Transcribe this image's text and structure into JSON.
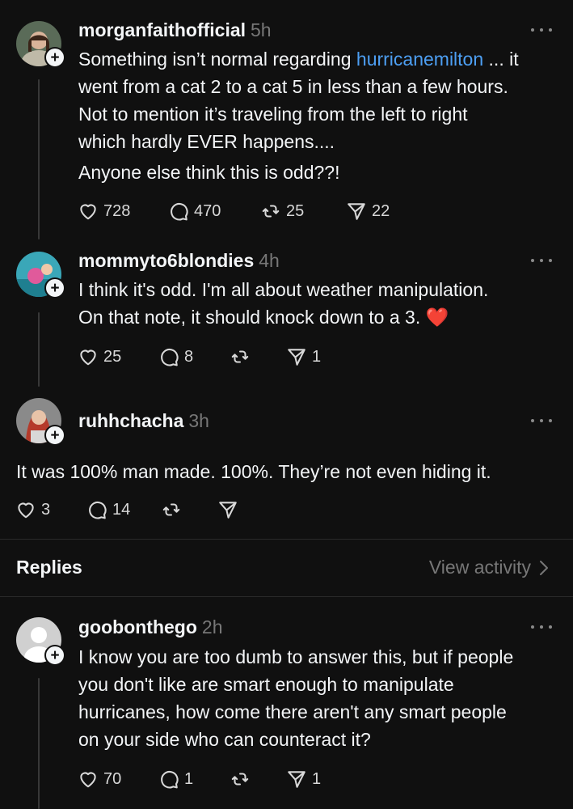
{
  "posts": [
    {
      "username": "morganfaithofficial",
      "time": "5h",
      "lines": [
        "Something isn’t normal regarding ",
        "hurricanemilton",
        " ... it",
        "went from a cat 2 to a cat 5 in less than a few hours.",
        "Not to mention it’s traveling from the left to right",
        "which hardly EVER happens....",
        "Anyone else think this is odd??!"
      ],
      "likes": "728",
      "replies": "470",
      "reposts": "25",
      "shares": "22"
    },
    {
      "username": "mommyto6blondies",
      "time": "4h",
      "lines": [
        "I think it's odd. I'm all about weather manipulation.",
        "On that note, it should knock down to a 3. ",
        "❤️"
      ],
      "likes": "25",
      "replies": "8",
      "reposts": "",
      "shares": "1"
    },
    {
      "username": "ruhhchacha",
      "time": "3h",
      "lines": [
        "It was 100% man made. 100%. They’re not even hiding it."
      ],
      "likes": "3",
      "replies": "14",
      "reposts": "",
      "shares": ""
    },
    {
      "username": "goobonthego",
      "time": "2h",
      "lines": [
        "I know you are too dumb to answer this, but if people",
        "you don't like are smart enough to manipulate",
        "hurricanes, how come there aren't any smart people",
        "on your side who can counteract it?"
      ],
      "likes": "70",
      "replies": "1",
      "reposts": "",
      "shares": "1"
    }
  ],
  "replies_section": {
    "label": "Replies",
    "view_activity": "View activity"
  },
  "colors": {
    "background": "#101010",
    "text": "#f3f5f7",
    "muted": "#777777",
    "link": "#4d9ff3",
    "heart": "#e0245e"
  },
  "icons": [
    "more-icon",
    "heart-icon",
    "comment-icon",
    "repost-icon",
    "share-icon",
    "follow-plus-icon",
    "chevron-right-icon"
  ]
}
